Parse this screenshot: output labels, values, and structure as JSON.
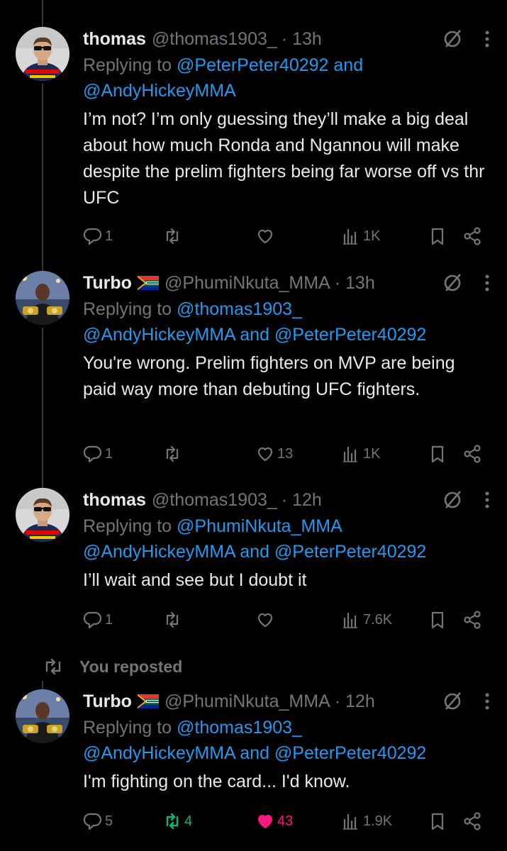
{
  "tweets": [
    {
      "avatar": "driver-portrait",
      "name": "thomas",
      "flag": "",
      "handle": "@thomas1903_",
      "time": "· 13h",
      "reply_prefix": "Replying to ",
      "reply_line1": "@PeterPeter40292 and",
      "reply_line2": "@AndyHickeyMMA",
      "text": "I’m not? I’m only guessing they’ll make a big deal about how much Ronda and Ngannou will make despite the prelim fighters being far worse off vs thr UFC",
      "replies": "1",
      "reposts": "",
      "likes": "",
      "views": "1K"
    },
    {
      "avatar": "fighter-with-belts",
      "name": "Turbo",
      "flag": "south-africa-flag",
      "handle": "@PhumiNkuta_MMA",
      "time": "· 13h",
      "reply_prefix": "Replying to ",
      "reply_line1": "@thomas1903_",
      "reply_line2": "@AndyHickeyMMA and @PeterPeter40292",
      "text": "You're wrong. Prelim fighters on MVP are being paid way more than debuting UFC fighters.",
      "replies": "1",
      "reposts": "",
      "likes": "13",
      "views": "1K"
    },
    {
      "avatar": "driver-portrait",
      "name": "thomas",
      "flag": "",
      "handle": "@thomas1903_",
      "time": "· 12h",
      "reply_prefix": "Replying to ",
      "reply_line1": "@PhumiNkuta_MMA",
      "reply_line2": "@AndyHickeyMMA and @PeterPeter40292",
      "text": "I’ll wait and see but I doubt it",
      "replies": "1",
      "reposts": "",
      "likes": "",
      "views": "7.6K"
    },
    {
      "avatar": "fighter-with-belts",
      "name": "Turbo",
      "flag": "south-africa-flag",
      "handle": "@PhumiNkuta_MMA",
      "time": "· 12h",
      "reply_prefix": "Replying to ",
      "reply_line1": "@thomas1903_",
      "reply_line2": "@AndyHickeyMMA and @PeterPeter40292",
      "text": "I'm fighting on the card... I'd know.",
      "replies": "5",
      "reposts": "4",
      "likes": "43",
      "views": "1.9K"
    }
  ],
  "repost_label": "You reposted",
  "colors": {
    "link": "#1d9bf0",
    "muted": "#71767b",
    "repost_active": "#00ba7c",
    "like_active": "#f91880",
    "background": "#000000"
  }
}
